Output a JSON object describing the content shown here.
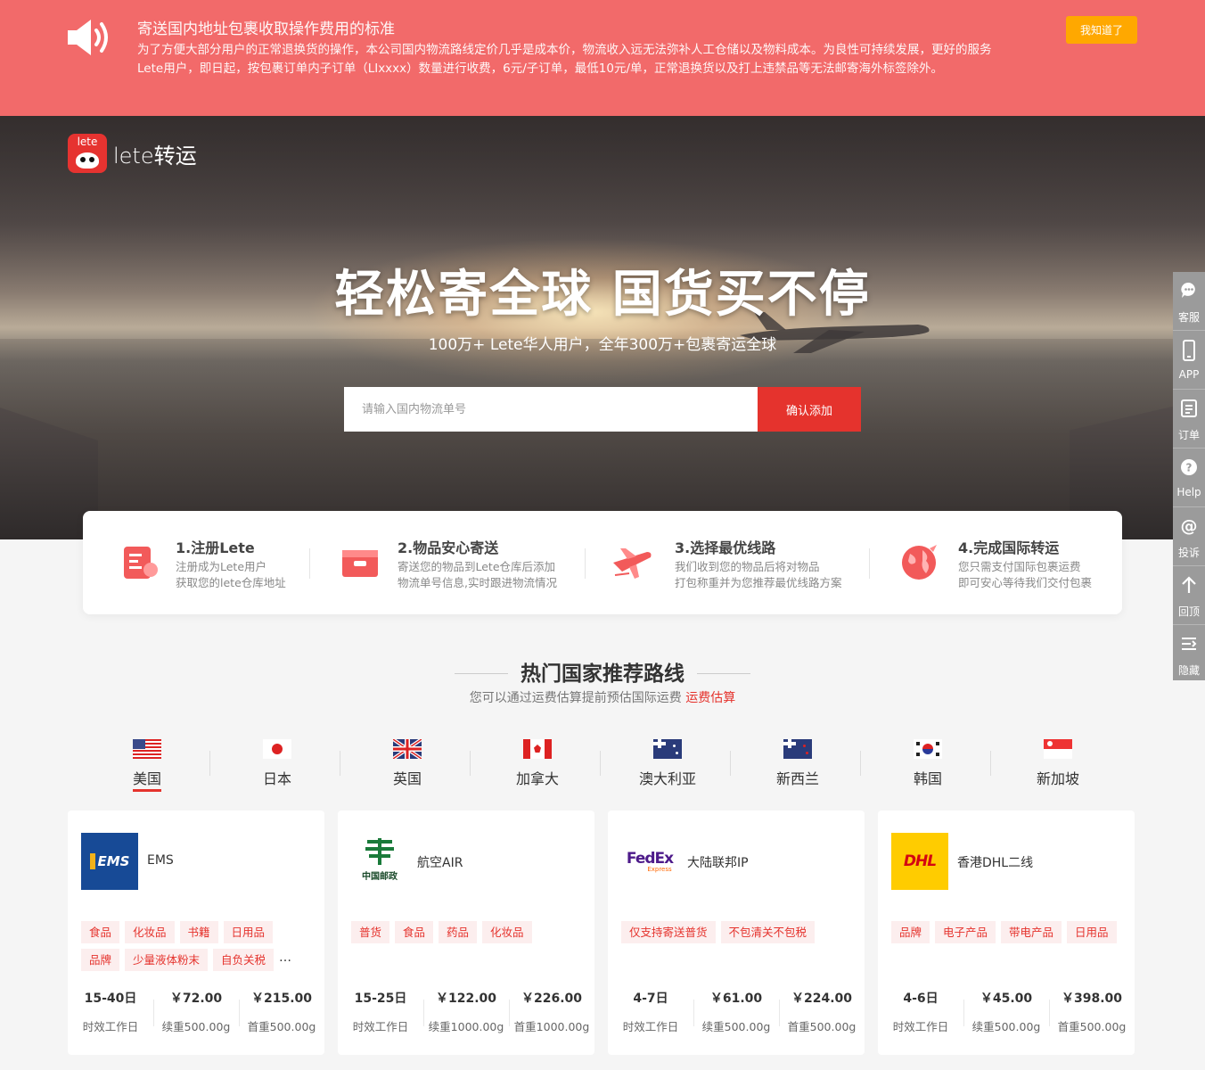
{
  "notice": {
    "title": "寄送国内地址包裹收取操作费用的标准",
    "line1": "为了方便大部分用户的正常退换货的操作，本公司国内物流路线定价几乎是成本价，物流收入远无法弥补人工仓储以及物料成本。为良性可持续发展，更好的服务",
    "line2": "Lete用户，即日起，按包裹订单内子订单（LIxxxx）数量进行收费，6元/子订单，最低10元/单，正常退换货以及打上违禁品等无法邮寄海外标签除外。",
    "ok_label": "我知道了"
  },
  "brand": {
    "logo_text": "lete",
    "name": "lete转运"
  },
  "hero": {
    "headline": "轻松寄全球 国货买不停",
    "subline": "100万+ Lete华人用户，全年300万+包裹寄运全球",
    "search_placeholder": "请输入国内物流单号",
    "confirm_label": "确认添加"
  },
  "steps": [
    {
      "title": "1.注册Lete",
      "desc1": "注册成为Lete用户",
      "desc2": "获取您的lete仓库地址"
    },
    {
      "title": "2.物品安心寄送",
      "desc1": "寄送您的物品到Lete仓库后添加",
      "desc2": "物流单号信息,实时跟进物流情况"
    },
    {
      "title": "3.选择最优线路",
      "desc1": "我们收到您的物品后将对物品",
      "desc2": "打包称重并为您推荐最优线路方案"
    },
    {
      "title": "4.完成国际转运",
      "desc1": "您只需支付国际包裹运费",
      "desc2": "即可安心等待我们交付包裹"
    }
  ],
  "section": {
    "title": "热门国家推荐路线",
    "subtitle": "您可以通过运费估算提前预估国际运费",
    "link": "运费估算"
  },
  "countries": [
    "美国",
    "日本",
    "英国",
    "加拿大",
    "澳大利亚",
    "新西兰",
    "韩国",
    "新加坡"
  ],
  "active_country": "美国",
  "routes": [
    {
      "carrier": "EMS",
      "logo": "EMS",
      "tags": [
        "食品",
        "化妆品",
        "书籍",
        "日用品",
        "品牌",
        "少量液体粉末",
        "自负关税"
      ],
      "more": "…",
      "days": "15-40日",
      "days_label": "时效工作日",
      "extra_price": "￥72.00",
      "extra_label": "续重500.00g",
      "first_price": "￥215.00",
      "first_label": "首重500.00g"
    },
    {
      "carrier": "航空AIR",
      "logo": "中国邮政",
      "tags": [
        "普货",
        "食品",
        "药品",
        "化妆品"
      ],
      "more": "",
      "days": "15-25日",
      "days_label": "时效工作日",
      "extra_price": "￥122.00",
      "extra_label": "续重1000.00g",
      "first_price": "￥226.00",
      "first_label": "首重1000.00g"
    },
    {
      "carrier": "大陆联邦IP",
      "logo": "FedEx",
      "logo_sub": "Express",
      "tags": [
        "仅支持寄送普货",
        "不包清关不包税"
      ],
      "more": "",
      "days": "4-7日",
      "days_label": "时效工作日",
      "extra_price": "￥61.00",
      "extra_label": "续重500.00g",
      "first_price": "￥224.00",
      "first_label": "首重500.00g"
    },
    {
      "carrier": "香港DHL二线",
      "logo": "DHL",
      "tags": [
        "品牌",
        "电子产品",
        "带电产品",
        "日用品"
      ],
      "more": "",
      "days": "4-6日",
      "days_label": "时效工作日",
      "extra_price": "￥45.00",
      "extra_label": "续重500.00g",
      "first_price": "￥398.00",
      "first_label": "首重500.00g"
    }
  ],
  "sidebar": [
    "客服",
    "APP",
    "订单",
    "Help",
    "投诉",
    "回顶",
    "隐藏"
  ],
  "colors": {
    "notice_bg": "#f26a6a",
    "brand_red": "#e5332d",
    "ok_orange": "#ffa800",
    "tag_bg": "#fceeee",
    "sidebar_bg": "#9b9b9b"
  }
}
